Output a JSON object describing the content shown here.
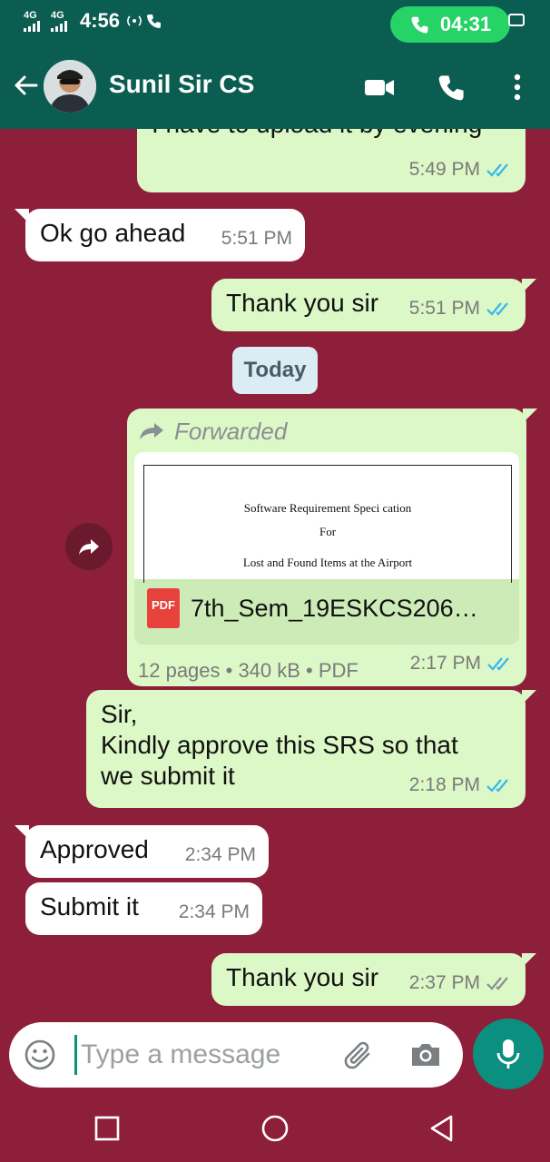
{
  "status_bar": {
    "network_1": "4G",
    "network_2": "4G",
    "time": "4:56",
    "call_timer": "04:31"
  },
  "header": {
    "contact_name": "Sunil Sir CS"
  },
  "messages": [
    {
      "direction": "out",
      "text": "I have to upload it by evening",
      "time": "5:49 PM",
      "status": "read"
    },
    {
      "direction": "in",
      "text": "Ok go ahead",
      "time": "5:51 PM"
    },
    {
      "direction": "out",
      "text": "Thank you sir",
      "time": "5:51 PM",
      "status": "read"
    },
    {
      "direction": "out",
      "time": "2:17 PM",
      "status": "read"
    },
    {
      "direction": "out",
      "text_lines": [
        "Sir,",
        "Kindly approve this SRS so that",
        "we submit it"
      ],
      "time": "2:18 PM",
      "status": "read"
    },
    {
      "direction": "in",
      "text": "Approved",
      "time": "2:34 PM"
    },
    {
      "direction": "in",
      "text": "Submit it",
      "time": "2:34 PM"
    },
    {
      "direction": "out",
      "text": "Thank you sir",
      "time": "2:37 PM",
      "status": "delivered"
    }
  ],
  "date_chip": "Today",
  "document": {
    "forwarded_label": "Forwarded",
    "preview_line_1": "Software Requirement Speci cation",
    "preview_line_2": "For",
    "preview_line_3": "Lost and Found Items at the Airport",
    "file_badge": "PDF",
    "file_name": "7th_Sem_19ESKCS206…",
    "details": "12 pages • 340 kB • PDF"
  },
  "input": {
    "placeholder": "Type a message"
  },
  "colors": {
    "wallpaper": "#8e1f3a",
    "header": "#0b5d52",
    "outgoing_bubble": "#dcf8c6",
    "incoming_bubble": "#ffffff",
    "read_tick": "#34b7f1",
    "accent": "#0b8f7e",
    "call_pill": "#25d366"
  },
  "icons": [
    "back-arrow-icon",
    "video-call-icon",
    "voice-call-icon",
    "more-menu-icon",
    "forward-icon",
    "pdf-icon",
    "emoji-icon",
    "attach-icon",
    "camera-icon",
    "mic-icon",
    "recents-nav-icon",
    "home-nav-icon",
    "back-nav-icon"
  ]
}
